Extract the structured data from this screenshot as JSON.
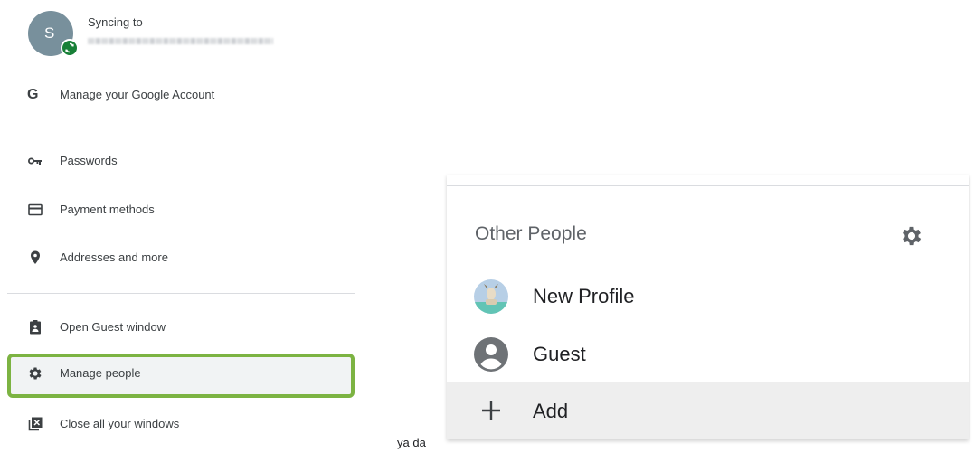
{
  "profile": {
    "avatar_initial": "S",
    "sync_label": "Syncing to"
  },
  "menu": {
    "google_account": {
      "icon": "google-g-icon",
      "label": "Manage your Google Account"
    },
    "passwords": {
      "icon": "key-icon",
      "label": "Passwords"
    },
    "payment_methods": {
      "icon": "credit-card-icon",
      "label": "Payment methods"
    },
    "addresses": {
      "icon": "location-pin-icon",
      "label": "Addresses and more"
    },
    "guest_window": {
      "icon": "guest-badge-icon",
      "label": "Open Guest window"
    },
    "manage_people": {
      "icon": "gear-icon",
      "label": "Manage people",
      "highlighted": true,
      "highlight_color": "#7cb342"
    },
    "close_windows": {
      "icon": "close-windows-icon",
      "label": "Close all your windows"
    }
  },
  "caption": "ya da",
  "other_people": {
    "title": "Other People",
    "settings_icon": "gear-icon",
    "people": [
      {
        "name": "New Profile",
        "icon": "profile-picture-icon"
      },
      {
        "name": "Guest",
        "icon": "account-circle-icon"
      }
    ],
    "add_label": "Add",
    "add_icon": "plus-icon"
  },
  "colors": {
    "avatar_bg": "#78909c",
    "sync_badge": "#188038",
    "text": "#3c4043",
    "add_row_bg": "#eeeeee"
  }
}
